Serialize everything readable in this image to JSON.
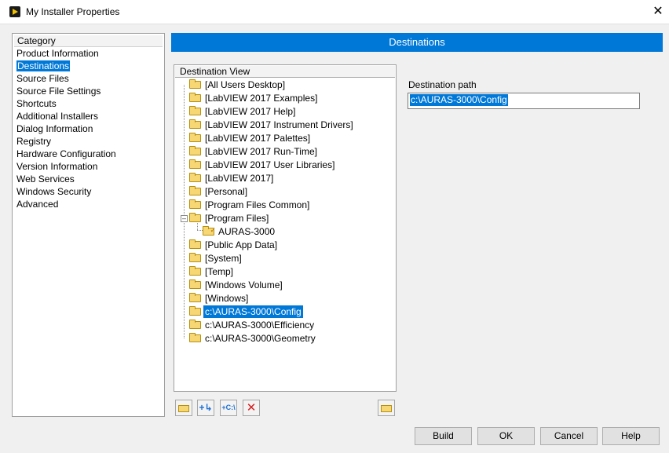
{
  "window": {
    "title": "My Installer Properties"
  },
  "category": {
    "header": "Category",
    "items": [
      "Product Information",
      "Destinations",
      "Source Files",
      "Source File Settings",
      "Shortcuts",
      "Additional Installers",
      "Dialog Information",
      "Registry",
      "Hardware Configuration",
      "Version Information",
      "Web Services",
      "Windows Security",
      "Advanced"
    ],
    "selected": "Destinations"
  },
  "section_title": "Destinations",
  "destination_view": {
    "header": "Destination View",
    "items": [
      "[All Users Desktop]",
      "[LabVIEW 2017 Examples]",
      "[LabVIEW 2017 Help]",
      "[LabVIEW 2017 Instrument Drivers]",
      "[LabVIEW 2017 Palettes]",
      "[LabVIEW 2017 Run-Time]",
      "[LabVIEW 2017 User Libraries]",
      "[LabVIEW 2017]",
      "[Personal]",
      "[Program Files Common]",
      "[Program Files]",
      "AURAS-3000",
      "[Public App Data]",
      "[System]",
      "[Temp]",
      "[Windows Volume]",
      "[Windows]",
      "c:\\AURAS-3000\\Config",
      "c:\\AURAS-3000\\Efficiency",
      "c:\\AURAS-3000\\Geometry"
    ],
    "selected": "c:\\AURAS-3000\\Config"
  },
  "destination_path": {
    "label": "Destination path",
    "value": "c:\\AURAS-3000\\Config"
  },
  "buttons": {
    "build": "Build",
    "ok": "OK",
    "cancel": "Cancel",
    "help": "Help"
  },
  "icons": {
    "app": "labview-icon",
    "close": "close-icon",
    "folder": "folder-icon",
    "add_folder": "add-folder-icon",
    "add_destination": "add-destination-icon",
    "add_path": "add-path-icon",
    "delete": "delete-icon"
  },
  "colors": {
    "accent": "#0078d7",
    "folder": "#f7d774",
    "delete": "#d62020"
  }
}
